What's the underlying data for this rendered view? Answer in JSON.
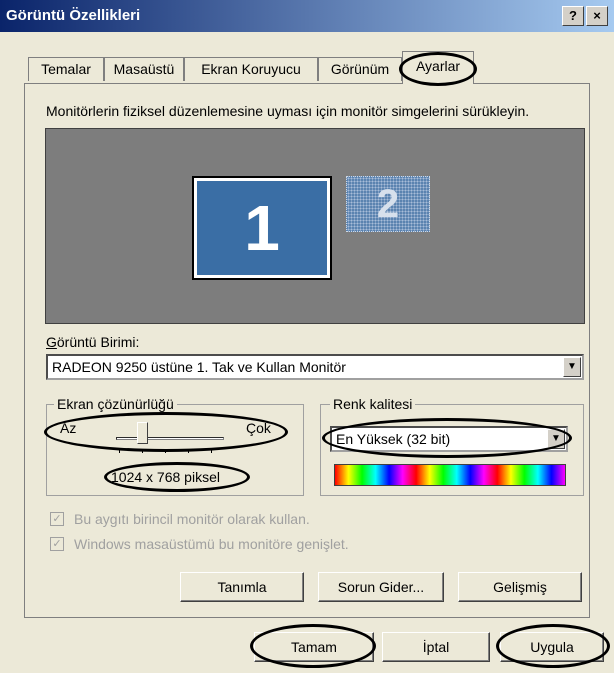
{
  "window": {
    "title": "Görüntü Özellikleri",
    "help_button": "?",
    "close_button": "×"
  },
  "tabs": [
    {
      "label": "Temalar"
    },
    {
      "label": "Masaüstü"
    },
    {
      "label": "Ekran Koruyucu"
    },
    {
      "label": "Görünüm"
    },
    {
      "label": "Ayarlar",
      "active": true
    }
  ],
  "settings": {
    "instruction": "Monitörlerin fiziksel düzenlemesine uyması için monitör simgelerini sürükleyin.",
    "monitor1_label": "1",
    "monitor2_label": "2",
    "display_label": "Görüntü Birimi:",
    "display_value": "RADEON 9250 üstüne 1. Tak ve Kullan Monitör",
    "resolution": {
      "title": "Ekran çözünürlüğü",
      "min_label": "Az",
      "max_label": "Çok",
      "value_text": "1024 x 768 piksel"
    },
    "color_quality": {
      "title": "Renk kalitesi",
      "value": "En Yüksek (32 bit)"
    },
    "checkbox_primary": "Bu aygıtı birincil monitör olarak kullan.",
    "checkbox_extend": "Windows masaüstümü bu monitöre genişlet.",
    "btn_identify": "Tanımla",
    "btn_troubleshoot": "Sorun Gider...",
    "btn_advanced": "Gelişmiş"
  },
  "footer": {
    "ok": "Tamam",
    "cancel": "İptal",
    "apply": "Uygula"
  }
}
